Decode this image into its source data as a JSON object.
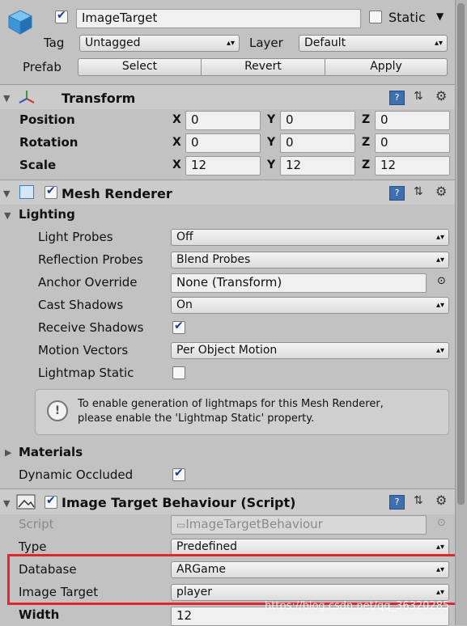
{
  "header": {
    "object_name": "ImageTarget",
    "active_checked": true,
    "static_label": "Static",
    "static_checked": false,
    "tag_label": "Tag",
    "tag_value": "Untagged",
    "layer_label": "Layer",
    "layer_value": "Default",
    "prefab_label": "Prefab",
    "select_label": "Select",
    "revert_label": "Revert",
    "apply_label": "Apply"
  },
  "transform": {
    "title": "Transform",
    "rows": [
      {
        "label": "Position",
        "x": "0",
        "y": "0",
        "z": "0"
      },
      {
        "label": "Rotation",
        "x": "0",
        "y": "0",
        "z": "0"
      },
      {
        "label": "Scale",
        "x": "12",
        "y": "12",
        "z": "12"
      }
    ],
    "axis_x": "X",
    "axis_y": "Y",
    "axis_z": "Z"
  },
  "mesh_renderer": {
    "title": "Mesh Renderer",
    "enabled": true,
    "lighting_label": "Lighting",
    "light_probes_label": "Light Probes",
    "light_probes_value": "Off",
    "reflection_probes_label": "Reflection Probes",
    "reflection_probes_value": "Blend Probes",
    "anchor_override_label": "Anchor Override",
    "anchor_override_value": "None (Transform)",
    "cast_shadows_label": "Cast Shadows",
    "cast_shadows_value": "On",
    "receive_shadows_label": "Receive Shadows",
    "receive_shadows_checked": true,
    "motion_vectors_label": "Motion Vectors",
    "motion_vectors_value": "Per Object Motion",
    "lightmap_static_label": "Lightmap Static",
    "lightmap_static_checked": false,
    "info_line1": "To enable generation of lightmaps for this Mesh Renderer,",
    "info_line2": "please enable the 'Lightmap Static' property.",
    "materials_label": "Materials",
    "dynamic_occluded_label": "Dynamic Occluded",
    "dynamic_occluded_checked": true
  },
  "image_target": {
    "title": "Image Target Behaviour (Script)",
    "enabled": true,
    "script_label": "Script",
    "script_value": "ImageTargetBehaviour",
    "type_label": "Type",
    "type_value": "Predefined",
    "database_label": "Database",
    "database_value": "ARGame",
    "image_target_label": "Image Target",
    "image_target_value": "player",
    "width_label": "Width",
    "width_value": "12"
  },
  "watermark": "https://blog.csdn.net/qq_36320285",
  "colors": {
    "highlight_box": "#e0262b",
    "checkbox_tick": "#1a3f8f"
  }
}
